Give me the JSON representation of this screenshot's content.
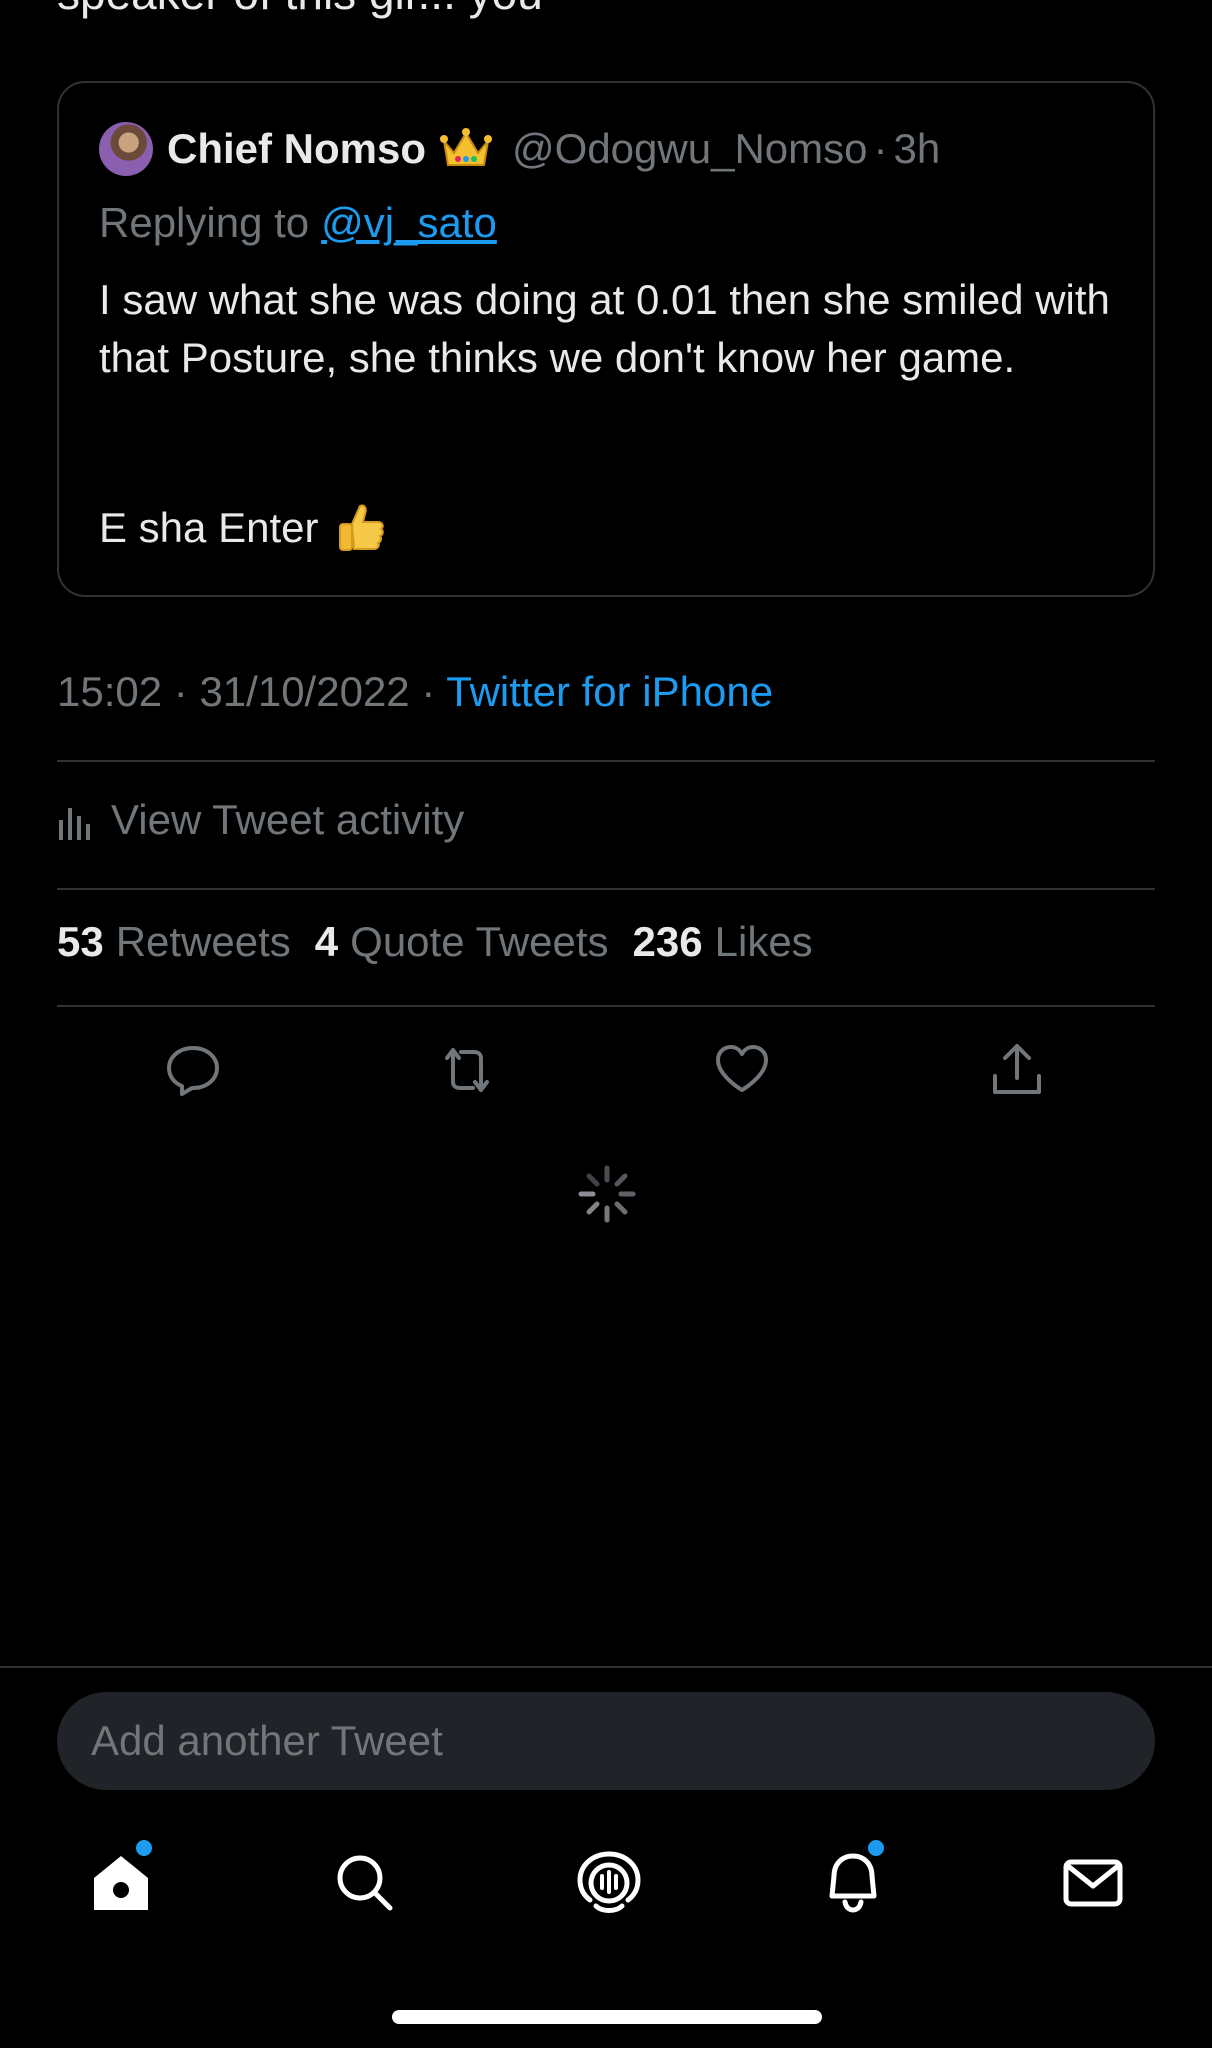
{
  "main_tweet": {
    "cut_text": "speaker of this gir... you"
  },
  "quoted_tweet": {
    "name": "Chief Nomso",
    "handle": "@Odogwu_Nomso",
    "separator": "·",
    "time": "3h",
    "replying_label": "Replying to",
    "replying_handle": "@vj_sato",
    "text_line1": "I saw what she was doing at 0.01 then she smiled with that Posture, she thinks we don't know her game.",
    "text_line2": "E sha Enter"
  },
  "meta": {
    "time": "15:02",
    "sep1": "·",
    "date": "31/10/2022",
    "sep2": "·",
    "source": "Twitter for iPhone"
  },
  "activity": {
    "label": "View Tweet activity"
  },
  "stats": {
    "retweets_count": "53",
    "retweets_label": "Retweets",
    "quotes_count": "4",
    "quotes_label": "Quote Tweets",
    "likes_count": "236",
    "likes_label": "Likes"
  },
  "actions": [
    "reply-icon",
    "retweet-icon",
    "like-icon",
    "share-icon"
  ],
  "compose": {
    "placeholder": "Add another Tweet"
  },
  "tabbar": {
    "tabs": [
      "home-icon",
      "search-icon",
      "spaces-icon",
      "notifications-icon",
      "messages-icon"
    ],
    "unread_dots_on": [
      "home",
      "notifications"
    ]
  },
  "colors": {
    "background": "#000000",
    "text": "#e7e9ea",
    "muted": "#71767b",
    "accent": "#1d9bf0",
    "border": "#2f3336"
  }
}
